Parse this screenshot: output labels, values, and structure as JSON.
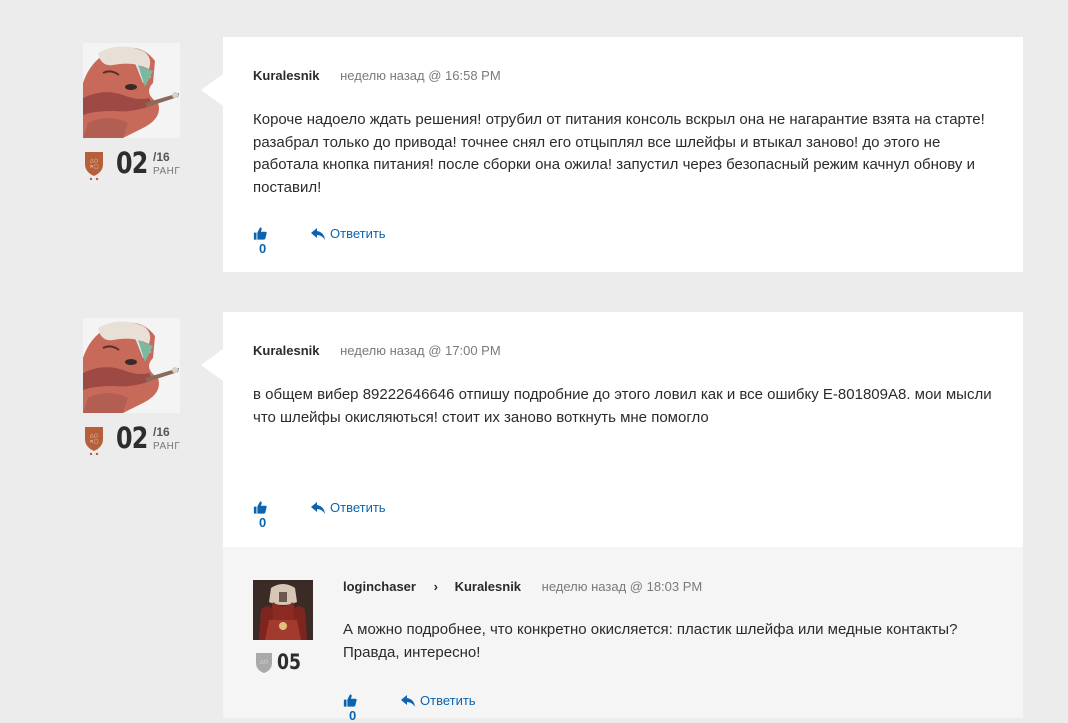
{
  "comments": [
    {
      "author": "Kuralesnik",
      "time": "неделю назад @ 16:58 PM",
      "text": "Короче надоело ждать решения! отрубил от питания консоль вскрыл она не нагарантие взята на старте! разабрал только до привода! точнее снял его отцыплял все шлейфы и втыкал заново! до этого не работала кнопка питания! после сборки она ожила! запустил через безопасный режим качнул обнову и поставил!",
      "rank": "02",
      "rank_max": "/16",
      "rank_word": "РАНГ",
      "likes": "0",
      "reply_label": "Ответить"
    },
    {
      "author": "Kuralesnik",
      "time": "неделю назад @ 17:00 PM",
      "text": "в общем вибер 89222646646 отпишу подробние до этого ловил как и все ошибку  E-801809A8. мои мысли что шлейфы окисляються! стоит их заново воткнуть мне помогло",
      "rank": "02",
      "rank_max": "/16",
      "rank_word": "РАНГ",
      "likes": "0",
      "reply_label": "Ответить"
    }
  ],
  "reply": {
    "author": "loginchaser",
    "reply_to": "Kuralesnik",
    "time": "неделю назад @ 18:03 PM",
    "text": "А можно подробнее, что конкретно окисляется: пластик шлейфа или медные контакты? Правда, интересно!",
    "rank": "05",
    "likes": "0",
    "reply_label": "Ответить"
  },
  "colors": {
    "link": "#0b64b0",
    "shield_bronze": "#b5603a",
    "shield_silver": "#a9a9a9"
  }
}
